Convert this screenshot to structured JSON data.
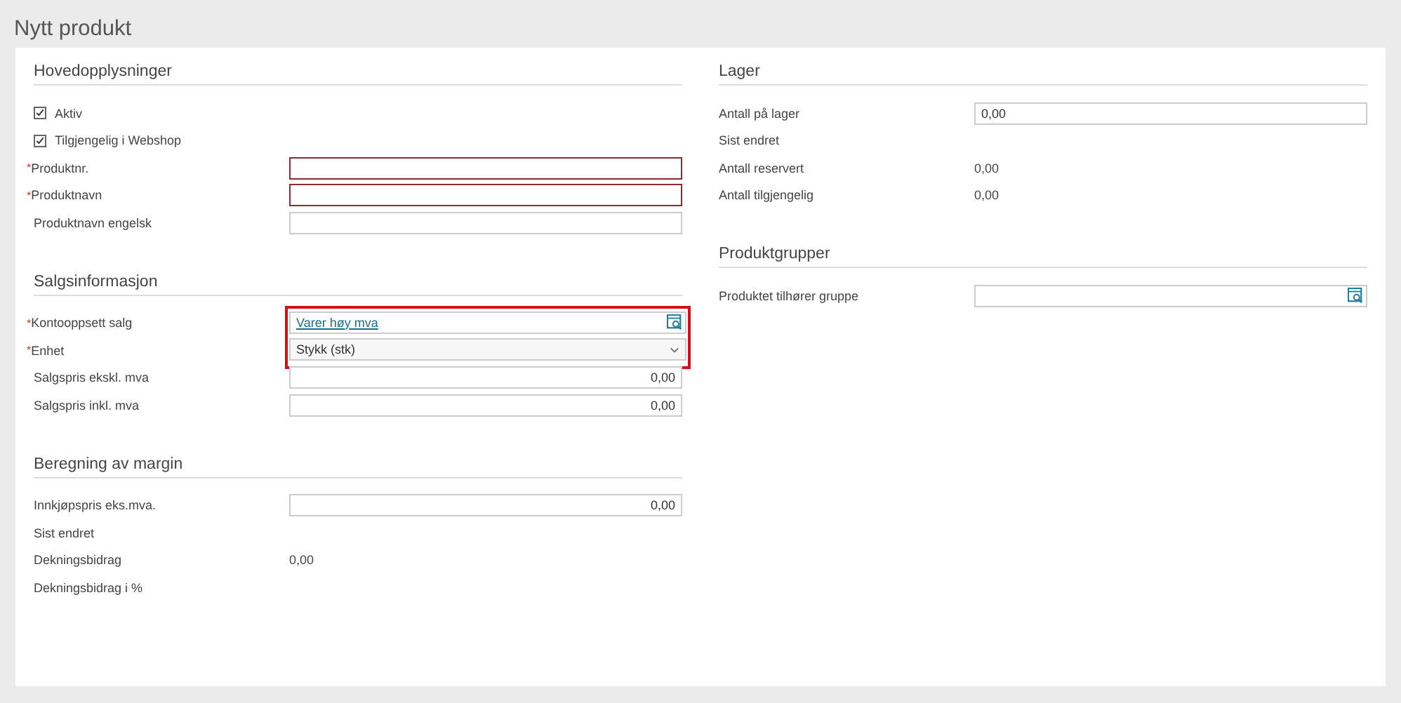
{
  "page_title": "Nytt produkt",
  "columns": [
    {
      "sections": [
        {
          "title": "Hovedopplysninger",
          "fields": [
            {
              "kind": "checkbox",
              "label": "Aktiv",
              "checked": true,
              "highlighted": false
            },
            {
              "kind": "checkbox",
              "label": "Tilgjengelig i Webshop",
              "checked": true,
              "highlighted": false
            },
            {
              "kind": "input",
              "required_mark": "*",
              "label": "Produktnr.",
              "invalid": true,
              "highlighted": false
            },
            {
              "kind": "input",
              "required_mark": "*",
              "label": "Produktnavn",
              "invalid": true,
              "highlighted": false
            },
            {
              "kind": "input",
              "label": "Produktnavn engelsk",
              "invalid": false,
              "highlighted": false
            }
          ]
        },
        {
          "title": "Salgsinformasjon",
          "fields": [
            {
              "kind": "lookup",
              "required_mark": "*",
              "label": "Kontooppsett salg",
              "value": "Varer høy mva",
              "highlighted": true
            },
            {
              "kind": "select",
              "required_mark": "*",
              "label": "Enhet",
              "value": "Stykk (stk)",
              "highlighted": true
            },
            {
              "kind": "amount",
              "label": "Salgspris ekskl. mva",
              "value": "0,00",
              "invalid": false,
              "highlighted": false
            },
            {
              "kind": "amount",
              "label": "Salgspris inkl. mva",
              "value": "0,00",
              "invalid": false,
              "highlighted": false
            }
          ]
        },
        {
          "title": "Beregning av margin",
          "fields": [
            {
              "kind": "amount",
              "label": "Innkjøpspris eks.mva.",
              "value": "0,00",
              "invalid": false,
              "highlighted": false
            },
            {
              "kind": "static",
              "label": "Sist endret",
              "highlighted": false
            },
            {
              "kind": "static",
              "label": "Dekningsbidrag",
              "value": "0,00",
              "highlighted": false
            },
            {
              "kind": "static",
              "label": "Dekningsbidrag i %",
              "highlighted": false
            }
          ]
        }
      ]
    },
    {
      "sections": [
        {
          "title": "Lager",
          "fields": [
            {
              "kind": "input",
              "label": "Antall på lager",
              "value": "0,00",
              "invalid": false,
              "highlighted": false
            },
            {
              "kind": "static",
              "label": "Sist endret",
              "highlighted": false
            },
            {
              "kind": "static",
              "label": "Antall reservert",
              "value": "0,00",
              "highlighted": false
            },
            {
              "kind": "static",
              "label": "Antall tilgjengelig",
              "value": "0,00",
              "highlighted": false
            }
          ]
        },
        {
          "title": "Produktgrupper",
          "fields": [
            {
              "kind": "lookup",
              "label": "Produktet tilhører gruppe",
              "highlighted": false
            }
          ]
        }
      ]
    }
  ]
}
